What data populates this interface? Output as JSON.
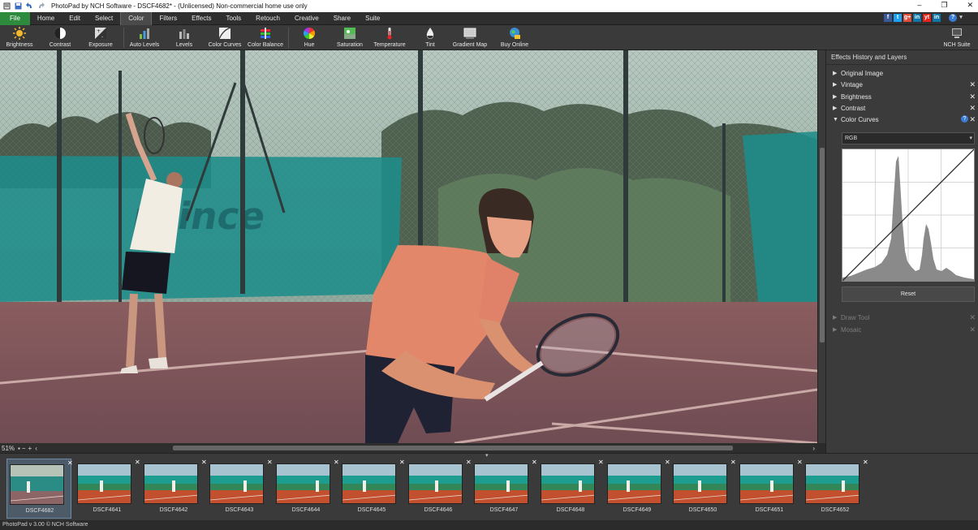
{
  "window": {
    "title": "PhotoPad by NCH Software - DSCF4682* - (Unlicensed) Non-commercial home use only",
    "controls": [
      "–",
      "❐",
      "✕"
    ]
  },
  "menu": [
    "File",
    "Home",
    "Edit",
    "Select",
    "Color",
    "Filters",
    "Effects",
    "Tools",
    "Retouch",
    "Creative",
    "Share",
    "Suite"
  ],
  "menu_active": "Color",
  "toolbar": {
    "brightness": "Brightness",
    "contrast": "Contrast",
    "exposure": "Exposure",
    "auto_levels": "Auto Levels",
    "levels": "Levels",
    "color_curves": "Color Curves",
    "color_balance": "Color Balance",
    "hue": "Hue",
    "saturation": "Saturation",
    "temperature": "Temperature",
    "tint": "Tint",
    "gradient_map": "Gradient Map",
    "buy_online": "Buy Online",
    "nch_suite": "NCH Suite"
  },
  "social_icons": [
    "f",
    "t",
    "g+",
    "in",
    "yt",
    "in"
  ],
  "canvas": {
    "zoom": "51%",
    "watermark": "prince"
  },
  "panel": {
    "title": "Effects History and Layers",
    "layers": [
      {
        "name": "Original Image",
        "closable": false,
        "expanded": false
      },
      {
        "name": "Vintage",
        "closable": true,
        "expanded": false
      },
      {
        "name": "Brightness",
        "closable": true,
        "expanded": false
      },
      {
        "name": "Contrast",
        "closable": true,
        "expanded": false
      },
      {
        "name": "Color Curves",
        "closable": true,
        "expanded": true
      }
    ],
    "channel": "RGB",
    "reset": "Reset",
    "tools": [
      {
        "name": "Draw Tool"
      },
      {
        "name": "Mosaic"
      }
    ]
  },
  "filmstrip": [
    "DSCF4682",
    "DSCF4641",
    "DSCF4642",
    "DSCF4643",
    "DSCF4644",
    "DSCF4645",
    "DSCF4646",
    "DSCF4647",
    "DSCF4648",
    "DSCF4649",
    "DSCF4650",
    "DSCF4651",
    "DSCF4652"
  ],
  "filmstrip_selected": "DSCF4682",
  "footer": "PhotoPad v 3.00 © NCH Software",
  "colors": {
    "file_menu": "#2e8b3e",
    "court": "#7d5658",
    "windscreen": "#1e8c8a",
    "shirt_front": "#e2876a"
  }
}
